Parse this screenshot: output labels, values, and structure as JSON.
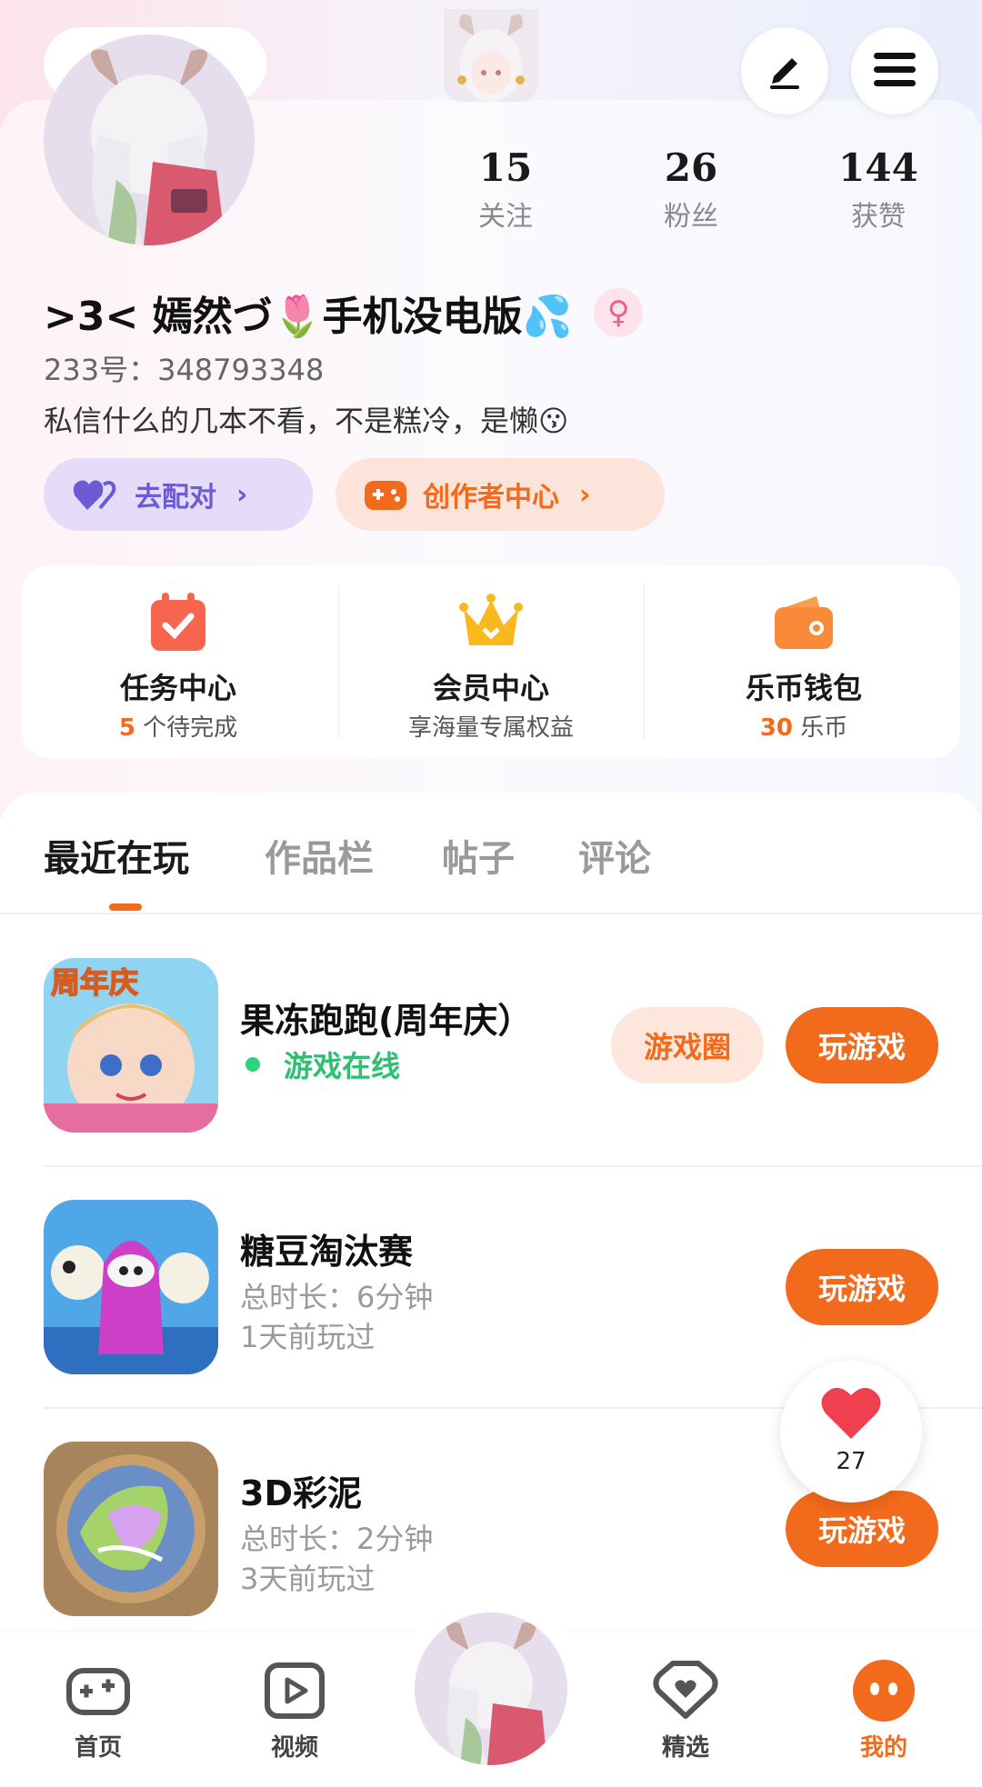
{
  "profile": {
    "stats": [
      {
        "value": "15",
        "label": "关注"
      },
      {
        "value": "26",
        "label": "粉丝"
      },
      {
        "value": "144",
        "label": "获赞"
      }
    ],
    "username": ">3< 嫣然づ🌷手机没电版💦",
    "gender_symbol": "♀",
    "uid": "233号：348793348",
    "bio": "私信什么的几本不看，不是糕冷，是懒😗"
  },
  "actions": {
    "pair_label": "去配对",
    "creator_label": "创作者中心",
    "chevron": "›"
  },
  "services": [
    {
      "title": "任务中心",
      "highlight": "5",
      "sub": " 个待完成",
      "icon": "calendar-check-icon",
      "color": "#f8654e"
    },
    {
      "title": "会员中心",
      "highlight": "",
      "sub": "享海量专属权益",
      "icon": "crown-icon",
      "color": "#f9b81e"
    },
    {
      "title": "乐币钱包",
      "highlight": "30",
      "sub": " 乐币",
      "icon": "wallet-icon",
      "color": "#f98a3a"
    }
  ],
  "tabs": [
    "最近在玩",
    "作品栏",
    "帖子",
    "评论"
  ],
  "games": [
    {
      "name": "果冻跑跑(周年庆）",
      "status": "游戏在线",
      "secondary_btn": "游戏圈",
      "play_btn": "玩游戏"
    },
    {
      "name": "糖豆淘汰赛",
      "duration": "总时长：6分钟",
      "last_played": "1天前玩过",
      "play_btn": "玩游戏"
    },
    {
      "name": "3D彩泥",
      "duration": "总时长：2分钟",
      "last_played": "3天前玩过",
      "play_btn": "玩游戏"
    }
  ],
  "game_icon_labels": {
    "anniversary": "周年庆"
  },
  "like_float": {
    "count": "27"
  },
  "nav": [
    {
      "label": "首页",
      "icon": "gamepad-icon"
    },
    {
      "label": "视频",
      "icon": "play-video-icon"
    },
    {
      "label": "精选",
      "icon": "heart-shield-icon"
    },
    {
      "label": "我的",
      "icon": "face-icon"
    }
  ],
  "colors": {
    "accent": "#f26a1b",
    "online": "#2dbf72",
    "pair": "#6c5bd4"
  }
}
